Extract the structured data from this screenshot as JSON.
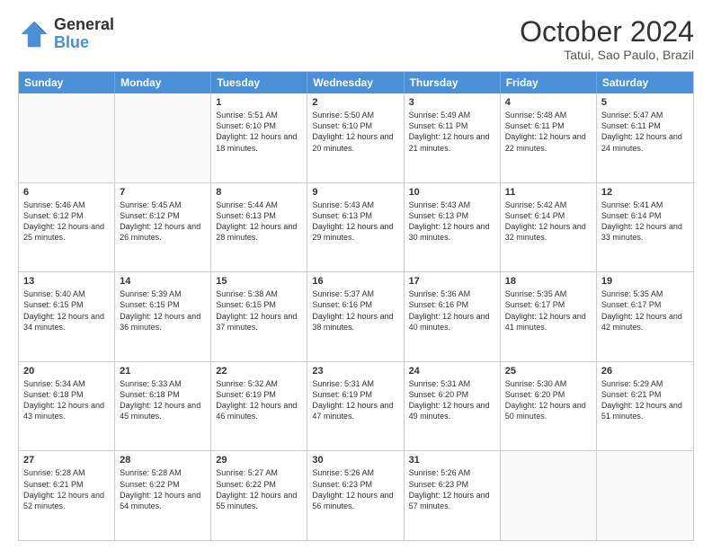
{
  "logo": {
    "line1": "General",
    "line2": "Blue"
  },
  "title": "October 2024",
  "location": "Tatui, Sao Paulo, Brazil",
  "header_days": [
    "Sunday",
    "Monday",
    "Tuesday",
    "Wednesday",
    "Thursday",
    "Friday",
    "Saturday"
  ],
  "weeks": [
    [
      {
        "day": "",
        "info": ""
      },
      {
        "day": "",
        "info": ""
      },
      {
        "day": "1",
        "info": "Sunrise: 5:51 AM\nSunset: 6:10 PM\nDaylight: 12 hours and 18 minutes."
      },
      {
        "day": "2",
        "info": "Sunrise: 5:50 AM\nSunset: 6:10 PM\nDaylight: 12 hours and 20 minutes."
      },
      {
        "day": "3",
        "info": "Sunrise: 5:49 AM\nSunset: 6:11 PM\nDaylight: 12 hours and 21 minutes."
      },
      {
        "day": "4",
        "info": "Sunrise: 5:48 AM\nSunset: 6:11 PM\nDaylight: 12 hours and 22 minutes."
      },
      {
        "day": "5",
        "info": "Sunrise: 5:47 AM\nSunset: 6:11 PM\nDaylight: 12 hours and 24 minutes."
      }
    ],
    [
      {
        "day": "6",
        "info": "Sunrise: 5:46 AM\nSunset: 6:12 PM\nDaylight: 12 hours and 25 minutes."
      },
      {
        "day": "7",
        "info": "Sunrise: 5:45 AM\nSunset: 6:12 PM\nDaylight: 12 hours and 26 minutes."
      },
      {
        "day": "8",
        "info": "Sunrise: 5:44 AM\nSunset: 6:13 PM\nDaylight: 12 hours and 28 minutes."
      },
      {
        "day": "9",
        "info": "Sunrise: 5:43 AM\nSunset: 6:13 PM\nDaylight: 12 hours and 29 minutes."
      },
      {
        "day": "10",
        "info": "Sunrise: 5:43 AM\nSunset: 6:13 PM\nDaylight: 12 hours and 30 minutes."
      },
      {
        "day": "11",
        "info": "Sunrise: 5:42 AM\nSunset: 6:14 PM\nDaylight: 12 hours and 32 minutes."
      },
      {
        "day": "12",
        "info": "Sunrise: 5:41 AM\nSunset: 6:14 PM\nDaylight: 12 hours and 33 minutes."
      }
    ],
    [
      {
        "day": "13",
        "info": "Sunrise: 5:40 AM\nSunset: 6:15 PM\nDaylight: 12 hours and 34 minutes."
      },
      {
        "day": "14",
        "info": "Sunrise: 5:39 AM\nSunset: 6:15 PM\nDaylight: 12 hours and 36 minutes."
      },
      {
        "day": "15",
        "info": "Sunrise: 5:38 AM\nSunset: 6:15 PM\nDaylight: 12 hours and 37 minutes."
      },
      {
        "day": "16",
        "info": "Sunrise: 5:37 AM\nSunset: 6:16 PM\nDaylight: 12 hours and 38 minutes."
      },
      {
        "day": "17",
        "info": "Sunrise: 5:36 AM\nSunset: 6:16 PM\nDaylight: 12 hours and 40 minutes."
      },
      {
        "day": "18",
        "info": "Sunrise: 5:35 AM\nSunset: 6:17 PM\nDaylight: 12 hours and 41 minutes."
      },
      {
        "day": "19",
        "info": "Sunrise: 5:35 AM\nSunset: 6:17 PM\nDaylight: 12 hours and 42 minutes."
      }
    ],
    [
      {
        "day": "20",
        "info": "Sunrise: 5:34 AM\nSunset: 6:18 PM\nDaylight: 12 hours and 43 minutes."
      },
      {
        "day": "21",
        "info": "Sunrise: 5:33 AM\nSunset: 6:18 PM\nDaylight: 12 hours and 45 minutes."
      },
      {
        "day": "22",
        "info": "Sunrise: 5:32 AM\nSunset: 6:19 PM\nDaylight: 12 hours and 46 minutes."
      },
      {
        "day": "23",
        "info": "Sunrise: 5:31 AM\nSunset: 6:19 PM\nDaylight: 12 hours and 47 minutes."
      },
      {
        "day": "24",
        "info": "Sunrise: 5:31 AM\nSunset: 6:20 PM\nDaylight: 12 hours and 49 minutes."
      },
      {
        "day": "25",
        "info": "Sunrise: 5:30 AM\nSunset: 6:20 PM\nDaylight: 12 hours and 50 minutes."
      },
      {
        "day": "26",
        "info": "Sunrise: 5:29 AM\nSunset: 6:21 PM\nDaylight: 12 hours and 51 minutes."
      }
    ],
    [
      {
        "day": "27",
        "info": "Sunrise: 5:28 AM\nSunset: 6:21 PM\nDaylight: 12 hours and 52 minutes."
      },
      {
        "day": "28",
        "info": "Sunrise: 5:28 AM\nSunset: 6:22 PM\nDaylight: 12 hours and 54 minutes."
      },
      {
        "day": "29",
        "info": "Sunrise: 5:27 AM\nSunset: 6:22 PM\nDaylight: 12 hours and 55 minutes."
      },
      {
        "day": "30",
        "info": "Sunrise: 5:26 AM\nSunset: 6:23 PM\nDaylight: 12 hours and 56 minutes."
      },
      {
        "day": "31",
        "info": "Sunrise: 5:26 AM\nSunset: 6:23 PM\nDaylight: 12 hours and 57 minutes."
      },
      {
        "day": "",
        "info": ""
      },
      {
        "day": "",
        "info": ""
      }
    ]
  ]
}
